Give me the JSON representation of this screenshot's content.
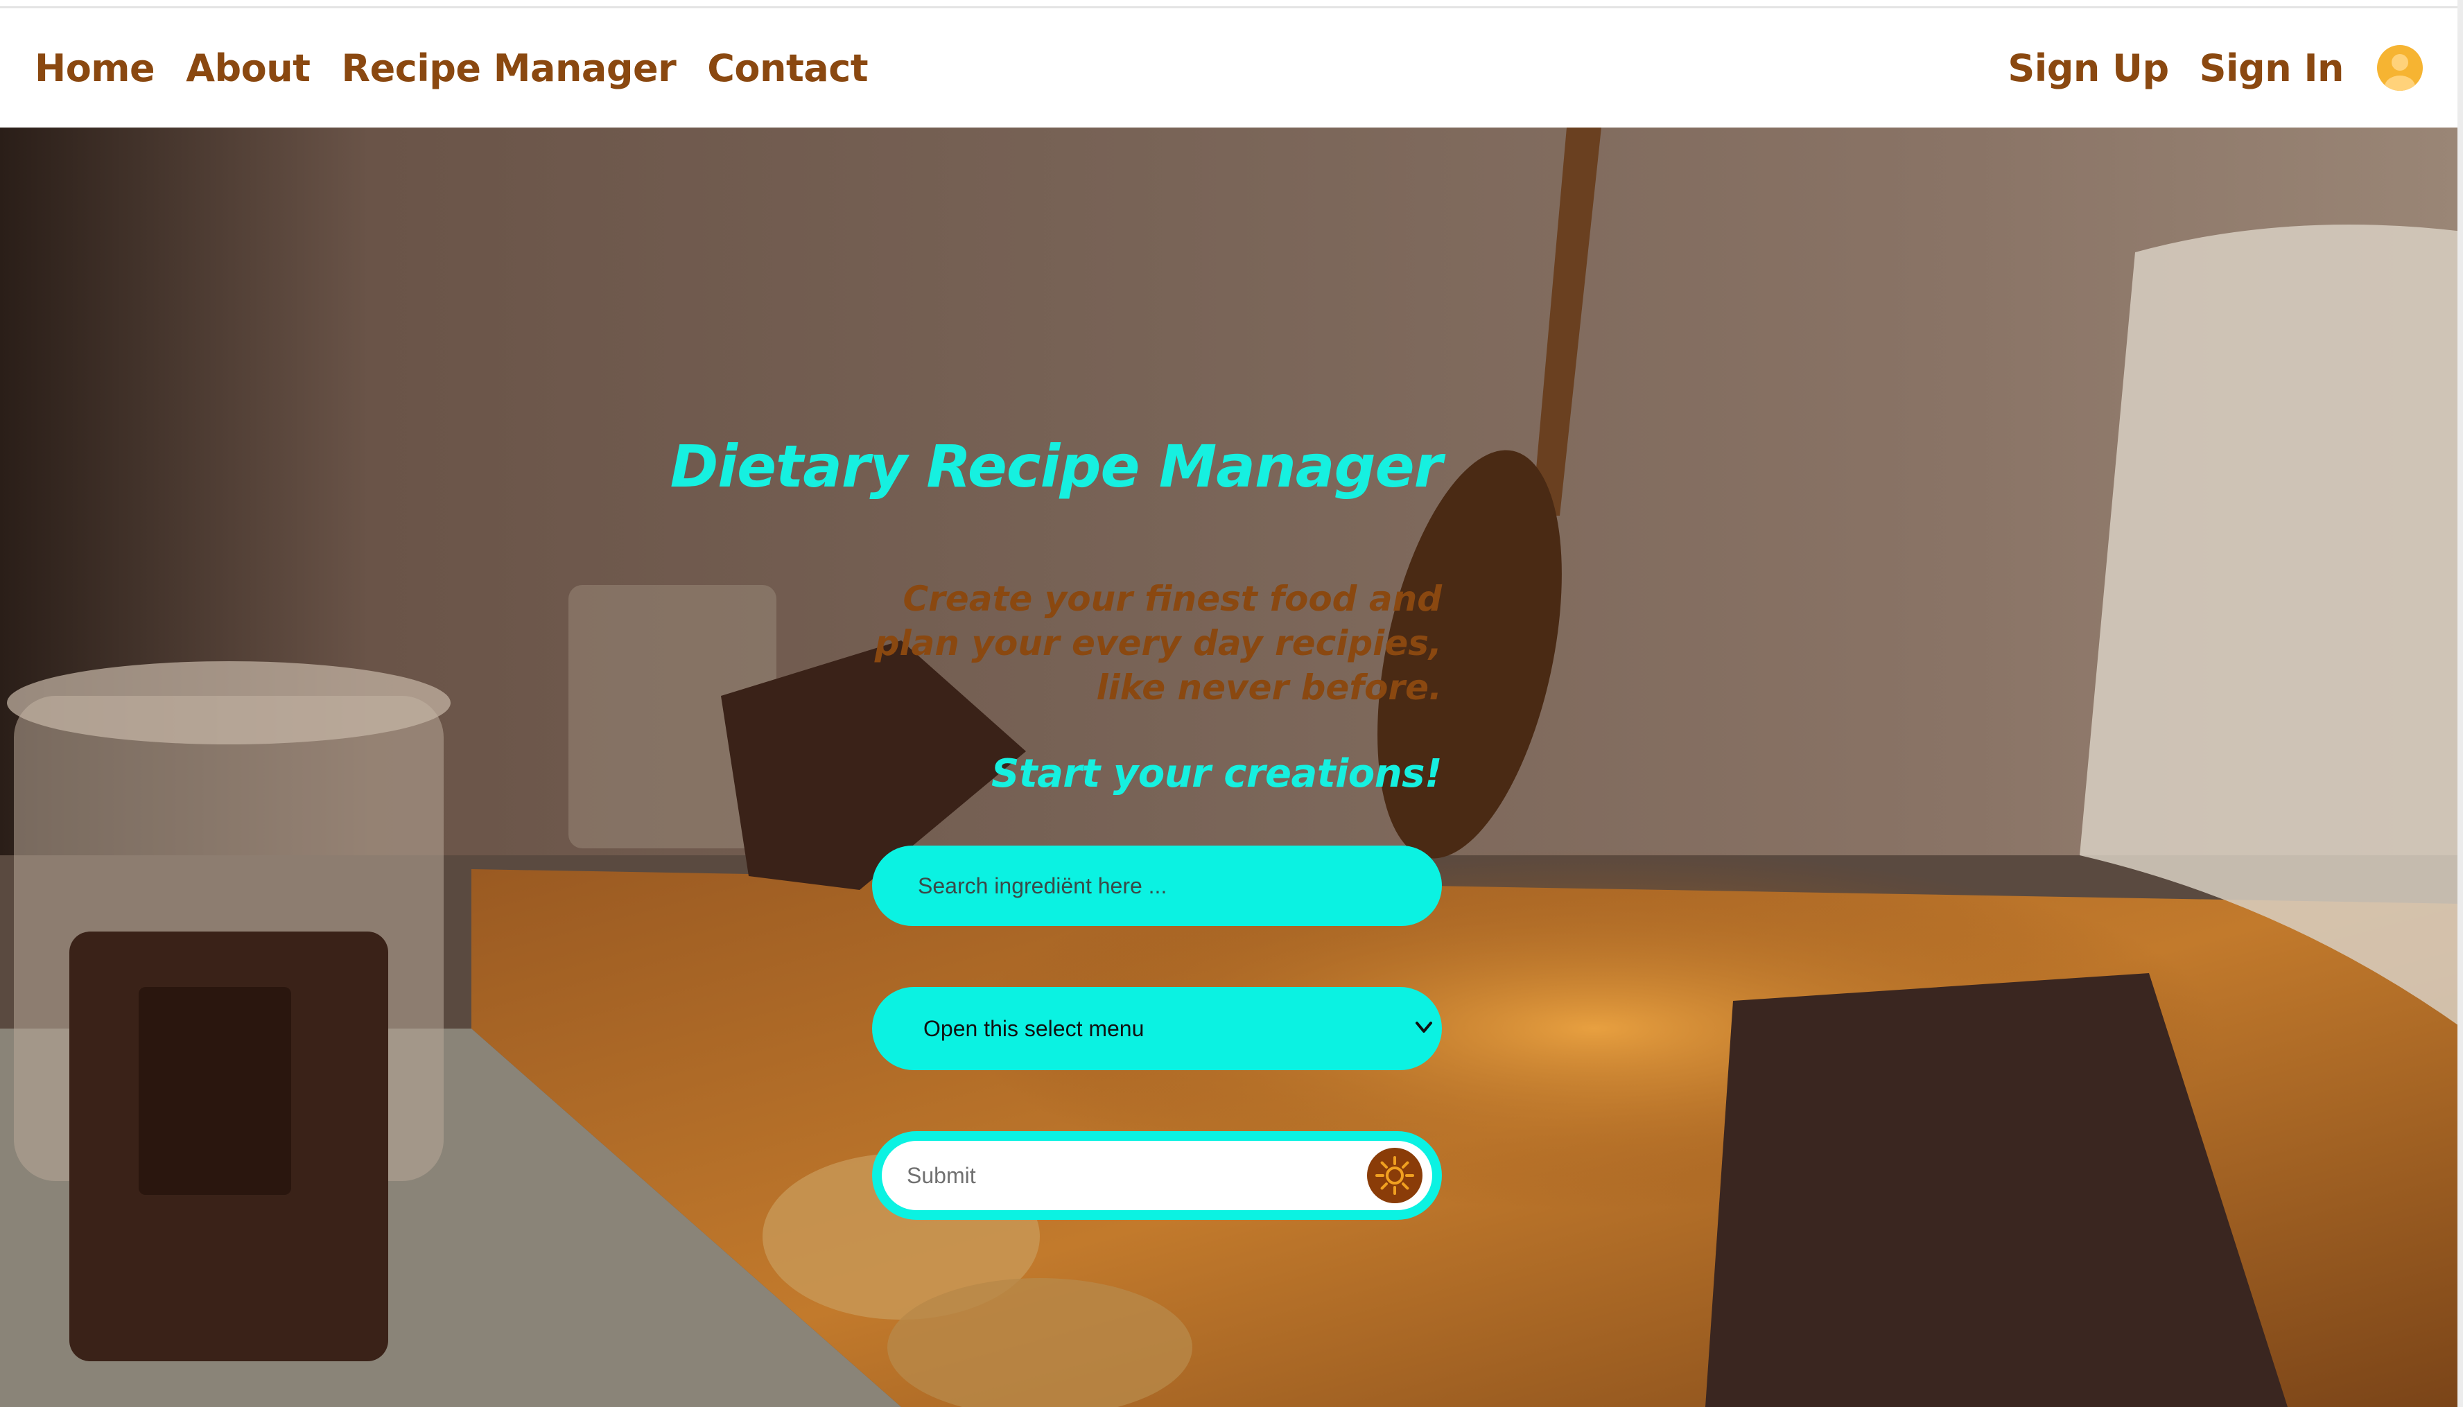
{
  "nav": {
    "left": [
      "Home",
      "About",
      "Recipe Manager",
      "Contact"
    ],
    "right": [
      "Sign Up",
      "Sign In"
    ]
  },
  "hero": {
    "title": "Dietary Recipe Manager",
    "subtitle": "Create your finest food and plan your every day recipies, like never before.",
    "cta": "Start your creations!",
    "search_placeholder": "Search ingrediënt here ...",
    "select_value": "Open this select menu",
    "submit_label": "Submit"
  },
  "colors": {
    "accent": "#0bf2e2",
    "brand_brown": "#8a4810",
    "avatar": "#f6b432"
  },
  "icons": [
    "user-avatar-icon",
    "chevron-down-icon",
    "sun-icon"
  ]
}
